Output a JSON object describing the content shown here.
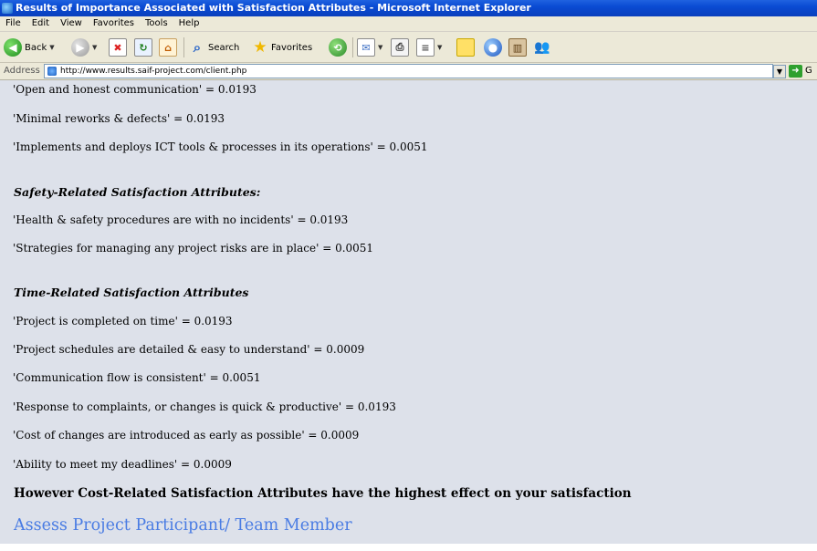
{
  "window": {
    "title": "Results of Importance Associated with Satisfaction Attributes - Microsoft Internet Explorer"
  },
  "menu": [
    "File",
    "Edit",
    "View",
    "Favorites",
    "Tools",
    "Help"
  ],
  "toolbar": {
    "back_label": "Back",
    "search_label": "Search",
    "favorites_label": "Favorites"
  },
  "address": {
    "label": "Address",
    "url": "http://www.results.saif-project.com/client.php",
    "go_label": "G"
  },
  "content": {
    "top_lines": [
      "'Open and honest communication' = 0.0193",
      "'Minimal reworks & defects' = 0.0193",
      "'Implements and deploys ICT tools & processes in its operations' = 0.0051"
    ],
    "safety": {
      "heading": "Safety-Related Satisfaction Attributes:",
      "lines": [
        "'Health & safety procedures are with no incidents' = 0.0193",
        "'Strategies for managing any project risks are in place' = 0.0051"
      ]
    },
    "time": {
      "heading": "Time-Related Satisfaction Attributes",
      "lines": [
        "'Project is completed on time' = 0.0193",
        "'Project schedules are detailed & easy to understand' = 0.0009",
        "'Communication flow is consistent' = 0.0051",
        "'Response to complaints, or changes is quick & productive' = 0.0193",
        "'Cost of changes are introduced as early as possible' = 0.0009",
        "'Ability to meet my deadlines' = 0.0009"
      ]
    },
    "summary": "However Cost-Related Satisfaction Attributes have the highest effect on your satisfaction",
    "link": "Assess Project Participant/ Team Member"
  }
}
